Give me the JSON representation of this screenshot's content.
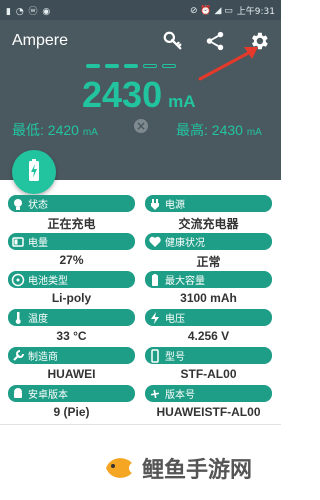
{
  "status": {
    "left_icons": "▮ ◔ ⓦ ◉",
    "right_text": "上午9:31",
    "right_icons": "⊘ ⏰ ◢ ▭"
  },
  "app": {
    "title": "Ampere"
  },
  "current": {
    "value": "2430",
    "unit": "mA"
  },
  "min": {
    "label": "最低: ",
    "value": "2420",
    "unit": "mA"
  },
  "max": {
    "label": "最高: ",
    "value": "2430",
    "unit": "mA"
  },
  "indicator": {
    "filled_segments": 3,
    "total_segments": 5
  },
  "colors": {
    "accent": "#22c4a0",
    "pill": "#1f9e87",
    "header": "#4a5960",
    "arrow": "#e5392b"
  },
  "info": [
    {
      "label": "状态",
      "value": "正在充电",
      "icon": "bulb-icon"
    },
    {
      "label": "电源",
      "value": "交流充电器",
      "icon": "plug-icon"
    },
    {
      "label": "电量",
      "value": "27%",
      "icon": "battery-icon"
    },
    {
      "label": "健康状况",
      "value": "正常",
      "icon": "heart-icon"
    },
    {
      "label": "电池类型",
      "value": "Li-poly",
      "icon": "cd-icon"
    },
    {
      "label": "最大容量",
      "value": "3100 mAh",
      "icon": "battery-full-icon"
    },
    {
      "label": "温度",
      "value": "33 °C",
      "icon": "thermometer-icon"
    },
    {
      "label": "电压",
      "value": "4.256 V",
      "icon": "bolt-icon"
    },
    {
      "label": "制造商",
      "value": "HUAWEI",
      "icon": "wrench-icon"
    },
    {
      "label": "型号",
      "value": "STF-AL00",
      "icon": "phone-icon"
    },
    {
      "label": "安卓版本",
      "value": "9 (Pie)",
      "icon": "android-icon"
    },
    {
      "label": "版本号",
      "value": "HUAWEISTF-AL00",
      "icon": "fan-icon"
    }
  ],
  "watermark": {
    "text": "鲤鱼手游网"
  }
}
